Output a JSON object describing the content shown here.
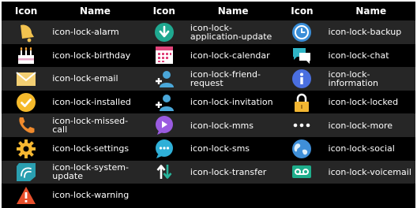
{
  "table": {
    "headers": [
      "Icon",
      "Name",
      "Icon",
      "Name",
      "Icon",
      "Name"
    ],
    "rows": [
      [
        {
          "icon": "alarm-bell-icon",
          "name": "icon-lock-alarm"
        },
        {
          "icon": "download-arrow-icon",
          "name": "icon-lock-application-update"
        },
        {
          "icon": "clock-backup-icon",
          "name": "icon-lock-backup"
        }
      ],
      [
        {
          "icon": "birthday-cake-icon",
          "name": "icon-lock-birthday"
        },
        {
          "icon": "calendar-icon",
          "name": "icon-lock-calendar"
        },
        {
          "icon": "chat-bubbles-icon",
          "name": "icon-lock-chat"
        }
      ],
      [
        {
          "icon": "envelope-icon",
          "name": "icon-lock-email"
        },
        {
          "icon": "add-friend-icon",
          "name": "icon-lock-friend-request"
        },
        {
          "icon": "info-icon",
          "name": "icon-lock-information"
        }
      ],
      [
        {
          "icon": "checkmark-icon",
          "name": "icon-lock-installed"
        },
        {
          "icon": "person-invite-icon",
          "name": "icon-lock-invitation"
        },
        {
          "icon": "padlock-icon",
          "name": "icon-lock-locked"
        }
      ],
      [
        {
          "icon": "phone-icon",
          "name": "icon-lock-missed-call"
        },
        {
          "icon": "mms-play-icon",
          "name": "icon-lock-mms"
        },
        {
          "icon": "more-dots-icon",
          "name": "icon-lock-more"
        }
      ],
      [
        {
          "icon": "gear-icon",
          "name": "icon-lock-settings"
        },
        {
          "icon": "sms-bubble-icon",
          "name": "icon-lock-sms"
        },
        {
          "icon": "globe-icon",
          "name": "icon-lock-social"
        }
      ],
      [
        {
          "icon": "system-update-icon",
          "name": "icon-lock-system-update"
        },
        {
          "icon": "transfer-arrows-icon",
          "name": "icon-lock-transfer"
        },
        {
          "icon": "voicemail-icon",
          "name": "icon-lock-voicemail"
        }
      ],
      [
        {
          "icon": "warning-triangle-icon",
          "name": "icon-lock-warning"
        }
      ]
    ]
  },
  "colors": {
    "background": "#000000",
    "row_stripe": "#262626",
    "text": "#ffffff"
  }
}
